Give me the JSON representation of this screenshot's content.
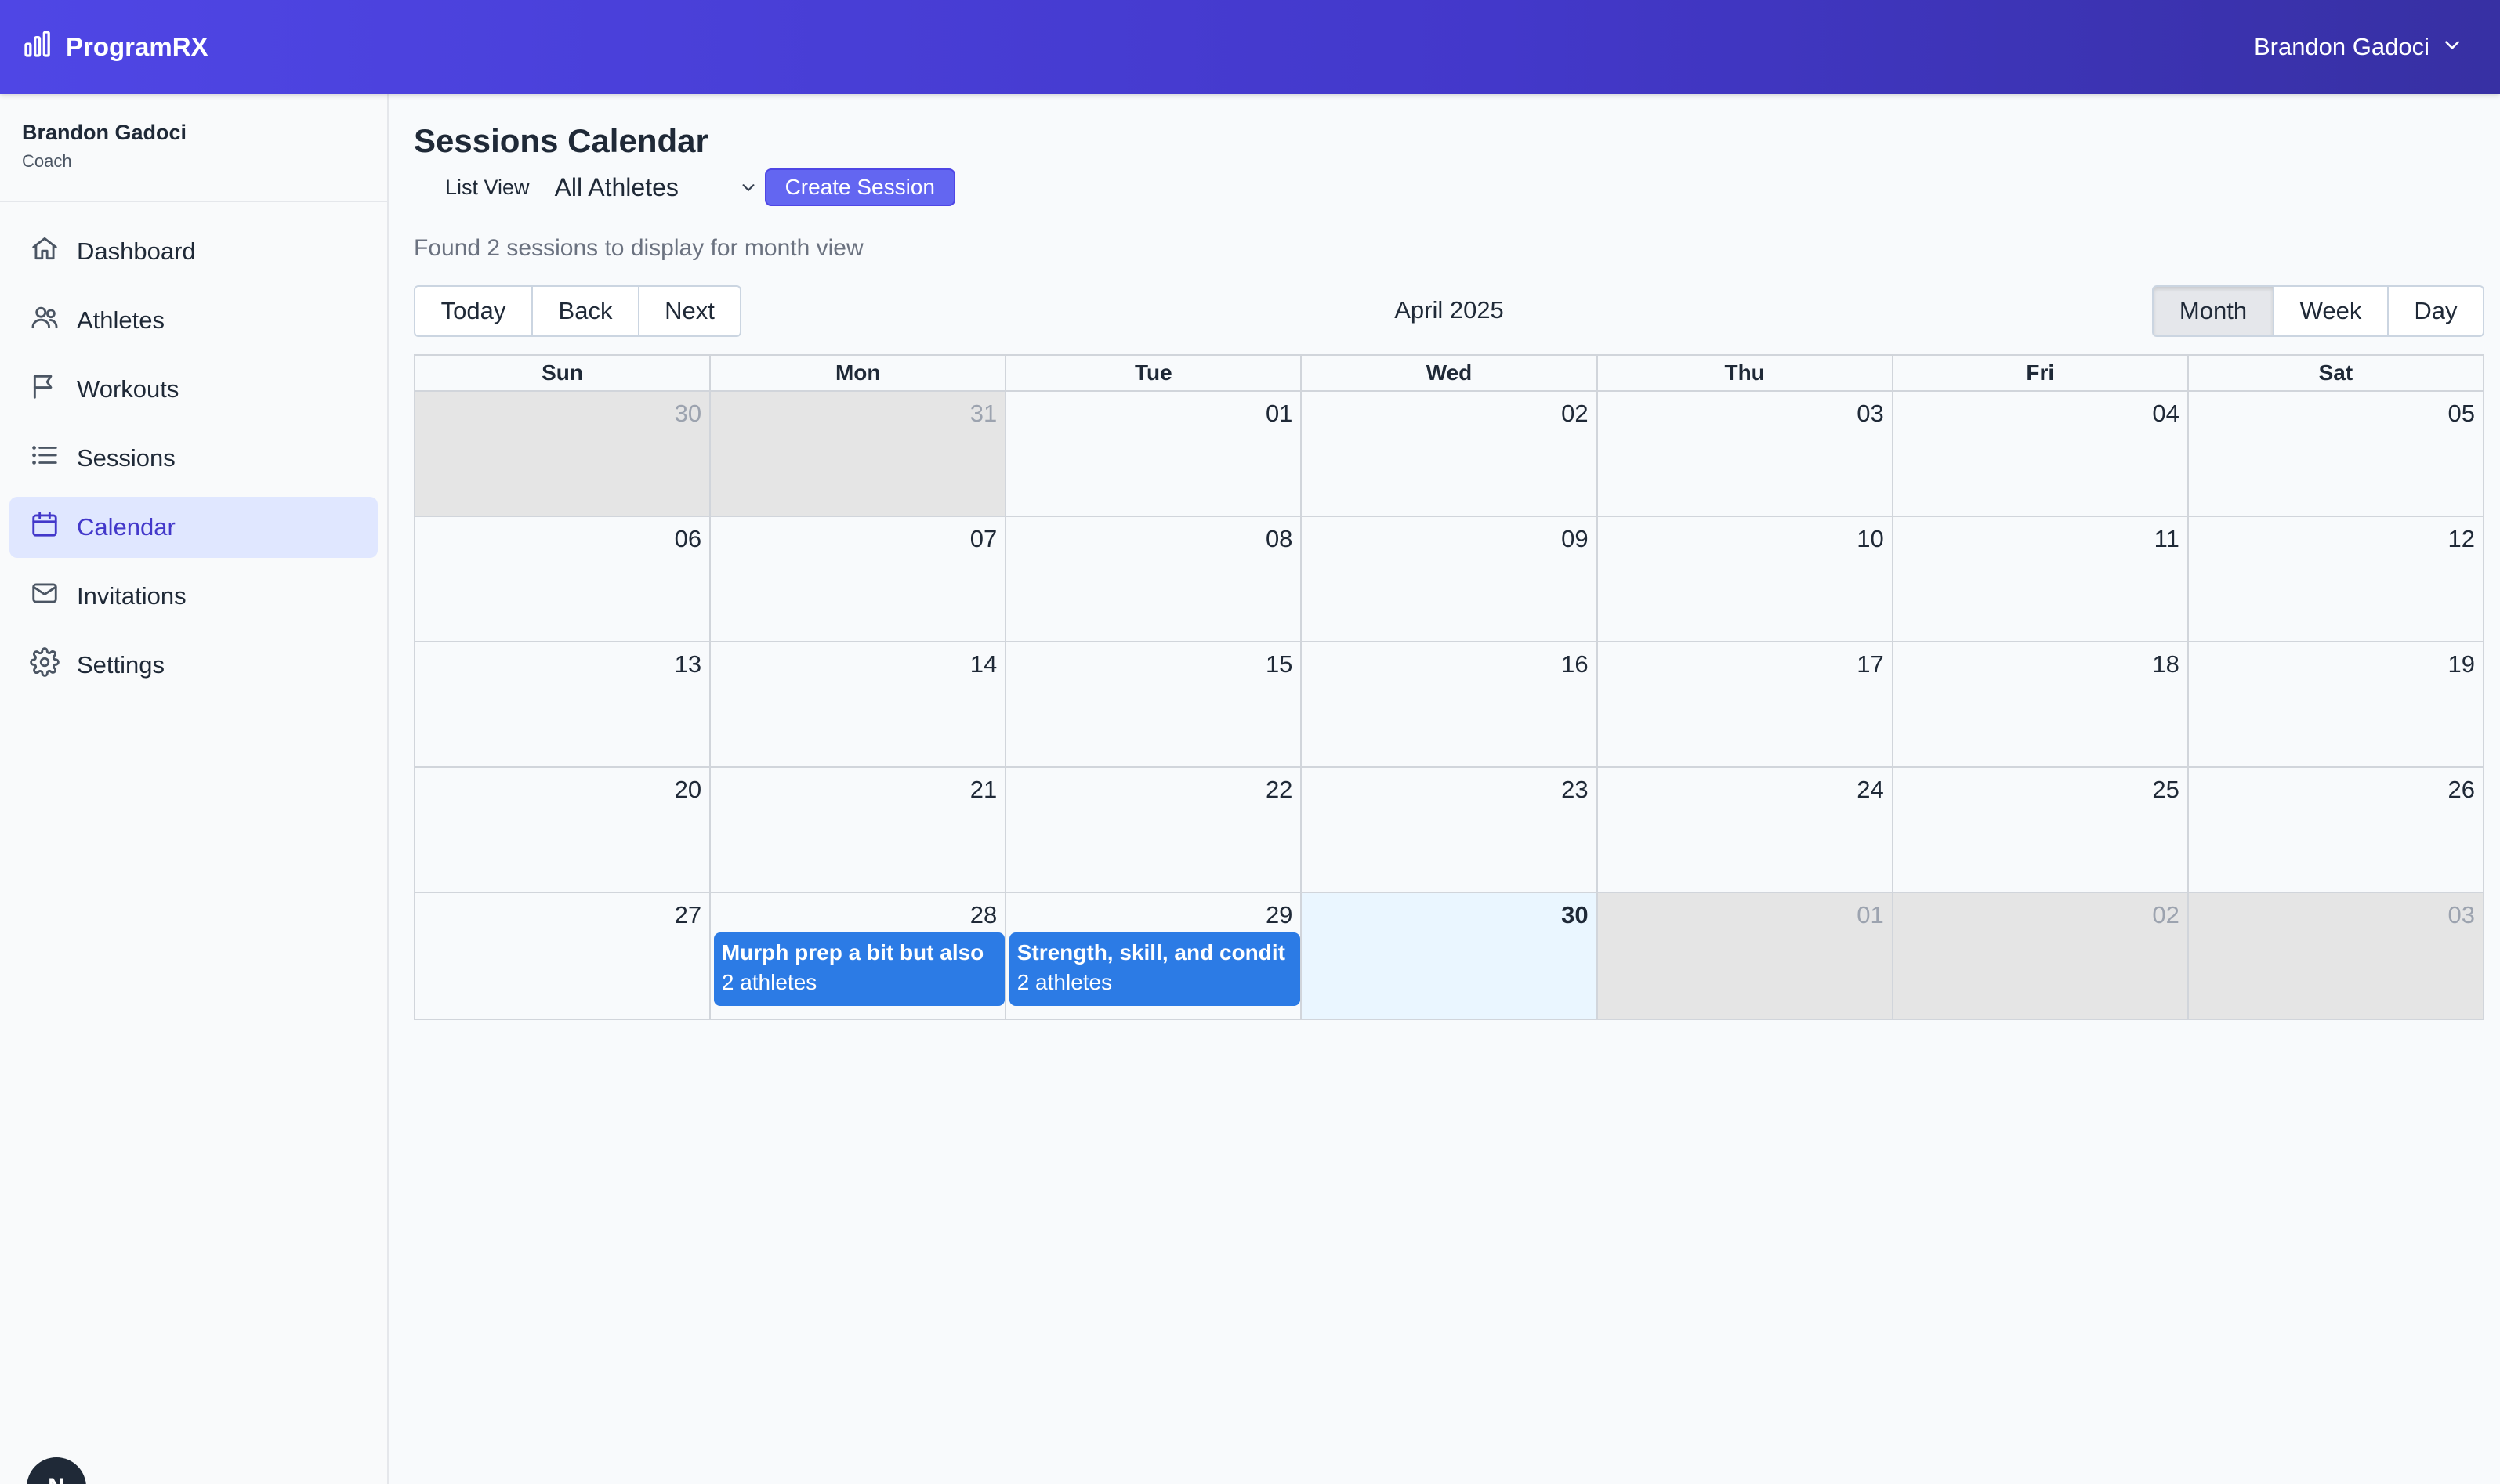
{
  "app": {
    "name": "ProgramRX"
  },
  "header": {
    "user_name": "Brandon Gadoci"
  },
  "sidebar": {
    "profile": {
      "name": "Brandon Gadoci",
      "role": "Coach"
    },
    "items": [
      {
        "label": "Dashboard",
        "icon": "home-icon"
      },
      {
        "label": "Athletes",
        "icon": "users-icon"
      },
      {
        "label": "Workouts",
        "icon": "flag-icon"
      },
      {
        "label": "Sessions",
        "icon": "list-icon"
      },
      {
        "label": "Calendar",
        "icon": "calendar-icon",
        "active": true
      },
      {
        "label": "Invitations",
        "icon": "mail-icon"
      },
      {
        "label": "Settings",
        "icon": "gear-icon"
      }
    ],
    "avatar_letter": "N"
  },
  "main": {
    "title": "Sessions Calendar",
    "list_view": "List View",
    "athlete_filter": "All Athletes",
    "create_button": "Create Session",
    "found_text": "Found 2 sessions to display for month view"
  },
  "calendar": {
    "nav": {
      "today": "Today",
      "back": "Back",
      "next": "Next"
    },
    "label": "April 2025",
    "views": {
      "month": "Month",
      "week": "Week",
      "day": "Day",
      "active": "month"
    },
    "weekdays": [
      "Sun",
      "Mon",
      "Tue",
      "Wed",
      "Thu",
      "Fri",
      "Sat"
    ],
    "weeks": [
      [
        {
          "d": "30",
          "off": true
        },
        {
          "d": "31",
          "off": true
        },
        {
          "d": "01"
        },
        {
          "d": "02"
        },
        {
          "d": "03"
        },
        {
          "d": "04"
        },
        {
          "d": "05"
        }
      ],
      [
        {
          "d": "06"
        },
        {
          "d": "07"
        },
        {
          "d": "08"
        },
        {
          "d": "09"
        },
        {
          "d": "10"
        },
        {
          "d": "11"
        },
        {
          "d": "12"
        }
      ],
      [
        {
          "d": "13"
        },
        {
          "d": "14"
        },
        {
          "d": "15"
        },
        {
          "d": "16"
        },
        {
          "d": "17"
        },
        {
          "d": "18"
        },
        {
          "d": "19"
        }
      ],
      [
        {
          "d": "20"
        },
        {
          "d": "21"
        },
        {
          "d": "22"
        },
        {
          "d": "23"
        },
        {
          "d": "24"
        },
        {
          "d": "25"
        },
        {
          "d": "26"
        }
      ],
      [
        {
          "d": "27"
        },
        {
          "d": "28"
        },
        {
          "d": "29"
        },
        {
          "d": "30",
          "today": true
        },
        {
          "d": "01",
          "off": true
        },
        {
          "d": "02",
          "off": true
        },
        {
          "d": "03",
          "off": true
        }
      ]
    ],
    "events": [
      {
        "week": 4,
        "day": 1,
        "title": "Murph prep a bit but also",
        "subtitle": "2 athletes"
      },
      {
        "week": 4,
        "day": 2,
        "title": "Strength, skill, and condit",
        "subtitle": "2 athletes"
      }
    ]
  },
  "colors": {
    "header": "#4f46e5",
    "accent": "#6366f1",
    "event": "#2c7be5",
    "active_nav": "#e0e7ff"
  }
}
